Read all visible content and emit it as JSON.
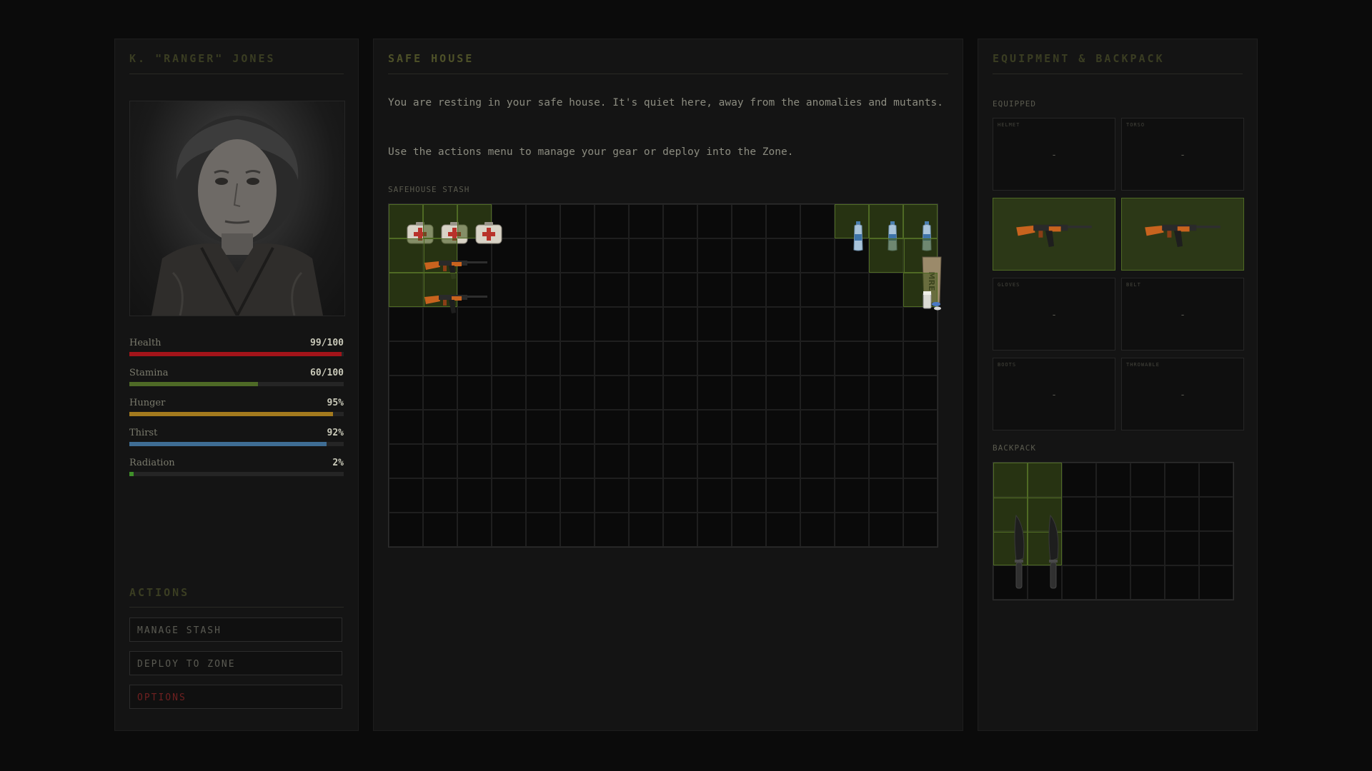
{
  "character": {
    "name": "K. \"RANGER\" JONES",
    "stats": [
      {
        "label": "Health",
        "value": "99/100",
        "fraction": 0.99,
        "color": "#a3141a"
      },
      {
        "label": "Stamina",
        "value": "60/100",
        "fraction": 0.6,
        "color": "#4e6a26"
      },
      {
        "label": "Hunger",
        "value": "95%",
        "fraction": 0.95,
        "color": "#a37a1e"
      },
      {
        "label": "Thirst",
        "value": "92%",
        "fraction": 0.92,
        "color": "#3f6d94"
      },
      {
        "label": "Radiation",
        "value": "2%",
        "fraction": 0.02,
        "color": "#3f8f2a"
      }
    ]
  },
  "actions": {
    "title": "ACTIONS",
    "manage_stash": "MANAGE STASH",
    "deploy": "DEPLOY TO ZONE",
    "options": "OPTIONS",
    "options_color": "#6e2020"
  },
  "safehouse": {
    "title": "SAFE HOUSE",
    "message1": "You are resting in your safe house. It's quiet here, away from the anomalies and mutants.",
    "message2": "Use the actions menu to manage your gear or deploy into the Zone.",
    "stash_label": "SAFEHOUSE STASH",
    "stash_items": [
      {
        "type": "medkit",
        "icon": "medkit-icon",
        "col": 0,
        "row": 0,
        "w": 1,
        "h": 1
      },
      {
        "type": "medkit",
        "icon": "medkit-icon",
        "col": 1,
        "row": 0,
        "w": 1,
        "h": 1
      },
      {
        "type": "medkit",
        "icon": "medkit-icon",
        "col": 2,
        "row": 0,
        "w": 1,
        "h": 1
      },
      {
        "type": "water",
        "icon": "water-bottle-icon",
        "col": 13,
        "row": 0,
        "w": 1,
        "h": 1
      },
      {
        "type": "water",
        "icon": "water-bottle-icon",
        "col": 14,
        "row": 0,
        "w": 1,
        "h": 1
      },
      {
        "type": "water",
        "icon": "water-bottle-icon",
        "col": 15,
        "row": 0,
        "w": 1,
        "h": 1
      },
      {
        "type": "rifle",
        "icon": "rifle-icon",
        "col": 0,
        "row": 1,
        "w": 2,
        "h": 1
      },
      {
        "type": "mre",
        "icon": "mre-ration-icon",
        "col": 14,
        "row": 1,
        "w": 2,
        "h": 1,
        "text": "MRE"
      },
      {
        "type": "rifle",
        "icon": "rifle-icon",
        "col": 0,
        "row": 2,
        "w": 2,
        "h": 1
      },
      {
        "type": "pills",
        "icon": "pills-icon",
        "col": 15,
        "row": 2,
        "w": 1,
        "h": 1
      }
    ]
  },
  "equipment": {
    "title": "EQUIPMENT & BACKPACK",
    "equipped_label": "EQUIPPED",
    "backpack_label": "BACKPACK",
    "slots": [
      {
        "label": "HELMET",
        "value": "-",
        "filled": false,
        "icon": ""
      },
      {
        "label": "TORSO",
        "value": "-",
        "filled": false,
        "icon": ""
      },
      {
        "label": "",
        "value": "",
        "filled": true,
        "icon": "rifle-icon"
      },
      {
        "label": "",
        "value": "",
        "filled": true,
        "icon": "rifle-icon"
      },
      {
        "label": "GLOVES",
        "value": "-",
        "filled": false,
        "icon": ""
      },
      {
        "label": "BELT",
        "value": "-",
        "filled": false,
        "icon": ""
      },
      {
        "label": "BOOTS",
        "value": "-",
        "filled": false,
        "icon": ""
      },
      {
        "label": "THROWABLE",
        "value": "-",
        "filled": false,
        "icon": ""
      }
    ],
    "backpack_items": [
      {
        "type": "knife",
        "icon": "machete-icon",
        "col": 0,
        "row": 0,
        "w": 1,
        "h": 3
      },
      {
        "type": "knife",
        "icon": "machete-icon",
        "col": 1,
        "row": 0,
        "w": 1,
        "h": 3
      }
    ]
  }
}
